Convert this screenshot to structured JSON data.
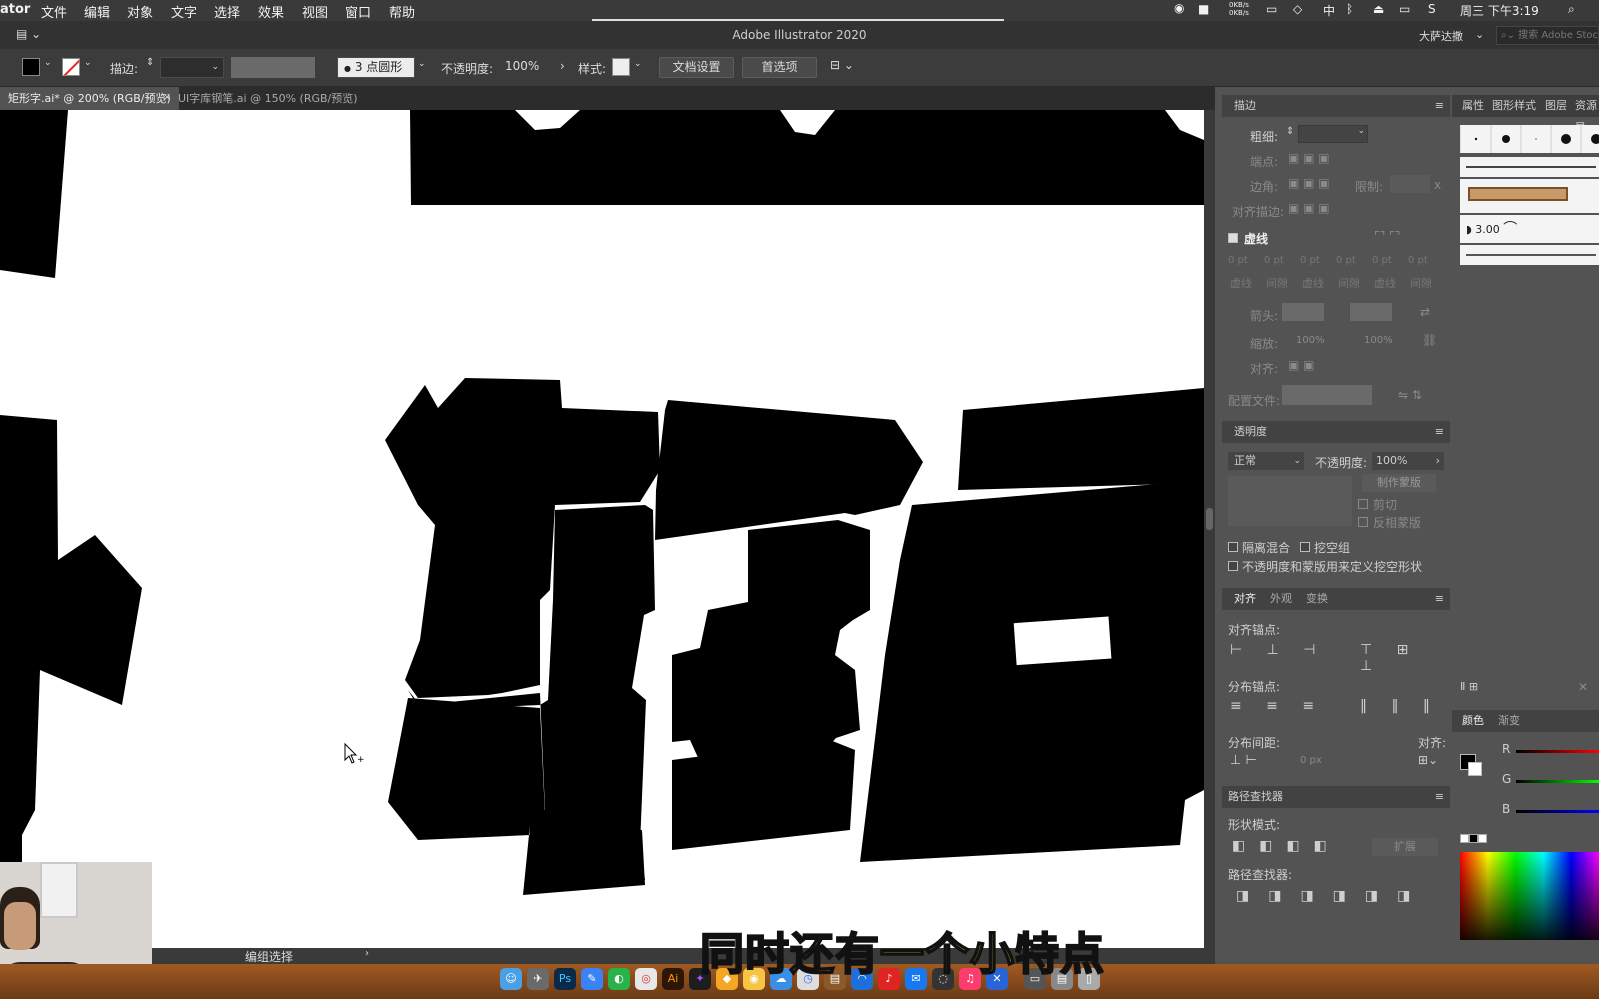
{
  "menubar": {
    "app": "ator",
    "items": [
      "文件",
      "编辑",
      "对象",
      "文字",
      "选择",
      "效果",
      "视图",
      "窗口",
      "帮助"
    ],
    "net_up": "0KB/s",
    "net_down": "0KB/s",
    "input_method": "中",
    "clock": "周三 下午3:19"
  },
  "titlebar": {
    "title": "Adobe Illustrator 2020",
    "workspace": "大萨达撒",
    "search_placeholder": "搜索 Adobe Stock"
  },
  "controlbar": {
    "stroke_label": "描边:",
    "brush_value": "3 点圆形",
    "opacity_label": "不透明度:",
    "opacity_value": "100%",
    "style_label": "样式:",
    "doc_setup": "文档设置",
    "preferences": "首选项"
  },
  "tabs": [
    {
      "label": "矩形字.ai* @ 200% (RGB/预览)"
    },
    {
      "label": "UI字库钢笔.ai @ 150% (RGB/预览)"
    }
  ],
  "status": {
    "tool": "编组选择"
  },
  "stroke_panel": {
    "title": "描边",
    "weight": "粗细:",
    "cap": "端点:",
    "corner": "边角:",
    "limit": "限制:",
    "limit_value": "x",
    "align_stroke": "对齐描边:",
    "dashed": "虚线",
    "dash_values": [
      "0 pt",
      "0 pt",
      "0 pt",
      "0 pt",
      "0 pt",
      "0 pt"
    ],
    "dash_labels": [
      "虚线",
      "间隙",
      "虚线",
      "间隙",
      "虚线",
      "间隙"
    ],
    "arrow": "箭头:",
    "scale": "缩放:",
    "scale_values": [
      "100%",
      "100%"
    ],
    "align": "对齐:",
    "profile": "配置文件:"
  },
  "transparency_panel": {
    "title": "透明度",
    "mode": "正常",
    "opacity_label": "不透明度:",
    "opacity_value": "100%",
    "make_mask": "制作蒙版",
    "clip": "剪切",
    "invert": "反相蒙版",
    "isolate": "隔离混合",
    "knockout": "挖空组",
    "define_knockout": "不透明度和蒙版用来定义挖空形状"
  },
  "align_panel": {
    "tabs": [
      "对齐",
      "外观",
      "变换"
    ],
    "align_anchors": "对齐锚点:",
    "distribute_anchors": "分布锚点:",
    "distribute_spacing": "分布间距:",
    "align_to": "对齐:",
    "spacing_value": "0 px"
  },
  "pathfinder_panel": {
    "title": "路径查找器",
    "shape_modes": "形状模式:",
    "expand": "扩展",
    "pathfinders": "路径查找器:"
  },
  "right_tabs": [
    "属性",
    "图形样式",
    "图层",
    "资源导"
  ],
  "brush_panel": {
    "weight": "3.00"
  },
  "color_panel": {
    "tabs": [
      "颜色",
      "渐变"
    ],
    "channels": [
      "R",
      "G",
      "B"
    ]
  },
  "subtitle": "同时还有一个小特点",
  "colors": {
    "accent": "#f4d021",
    "canvas": "#ffffff",
    "ui_dark": "#323232"
  }
}
